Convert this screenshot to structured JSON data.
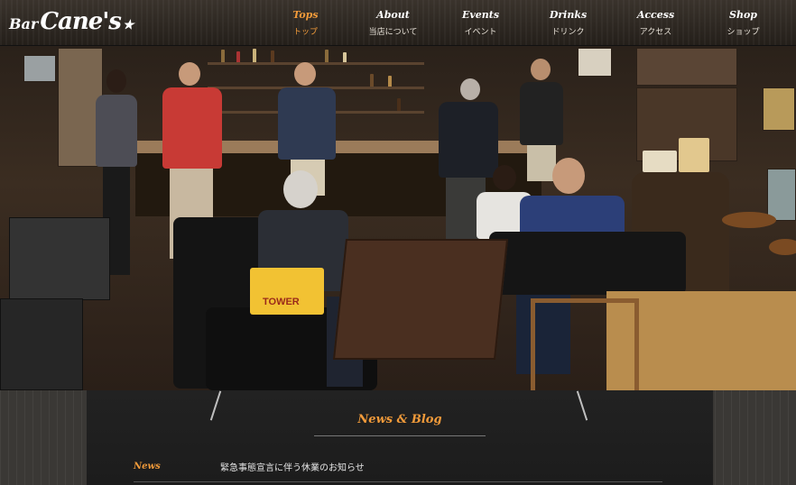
{
  "header": {
    "logo": {
      "prefix": "Bar",
      "name": "Cane's",
      "star": "★"
    },
    "nav": [
      {
        "en": "Tops",
        "ja": "トップ",
        "active": true
      },
      {
        "en": "About",
        "ja": "当店について"
      },
      {
        "en": "Events",
        "ja": "イベント"
      },
      {
        "en": "Drinks",
        "ja": "ドリンク"
      },
      {
        "en": "Access",
        "ja": "アクセス"
      },
      {
        "en": "Shop",
        "ja": "ショップ"
      }
    ]
  },
  "hero": {
    "bag_text": "TOWER"
  },
  "news": {
    "section_title": "News & Blog",
    "items": [
      {
        "category": "News",
        "title": "緊急事態宣言に伴う休業のお知らせ"
      }
    ]
  },
  "colors": {
    "accent": "#f09a3a",
    "header_bg": "#2e2822",
    "panel_bg": "#1f1f1f"
  },
  "icons": {
    "logo_star": "star-icon"
  }
}
